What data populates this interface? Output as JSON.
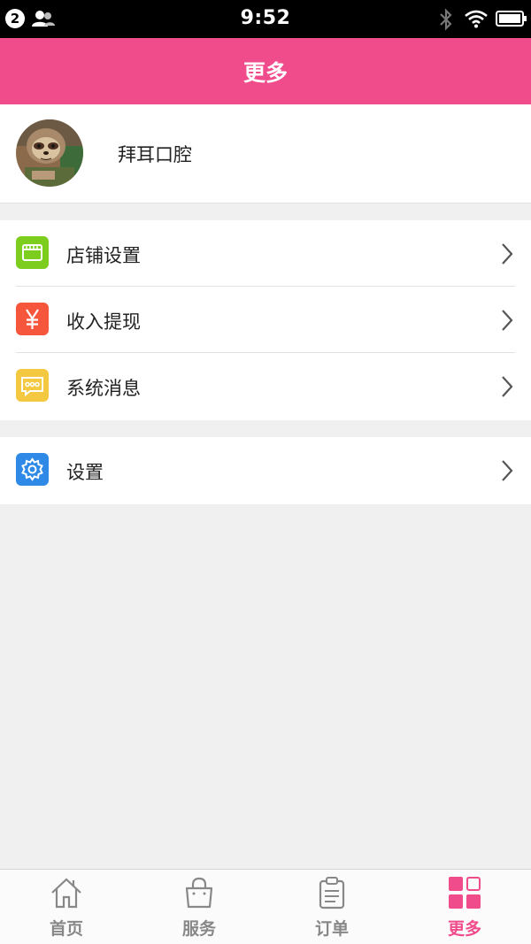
{
  "status_bar": {
    "notification_count": "2",
    "time": "9:52",
    "icons": [
      "user-icon",
      "bluetooth-icon",
      "wifi-icon",
      "battery-icon"
    ]
  },
  "header": {
    "title": "更多"
  },
  "profile": {
    "name": "拜耳口腔",
    "avatar_icon": "avatar-sloth-image"
  },
  "menu_groups": [
    {
      "items": [
        {
          "label": "店铺设置",
          "icon": "store-icon",
          "icon_color": "#7ccd1e"
        },
        {
          "label": "收入提现",
          "icon": "yuan-icon",
          "icon_color": "#f5563c"
        },
        {
          "label": "系统消息",
          "icon": "message-icon",
          "icon_color": "#f5c842"
        }
      ]
    },
    {
      "items": [
        {
          "label": "设置",
          "icon": "gear-icon",
          "icon_color": "#2e8ae6"
        }
      ]
    }
  ],
  "tabbar": {
    "active_index": 3,
    "items": [
      {
        "label": "首页",
        "icon": "home-icon"
      },
      {
        "label": "服务",
        "icon": "bag-icon"
      },
      {
        "label": "订单",
        "icon": "clipboard-icon"
      },
      {
        "label": "更多",
        "icon": "grid-icon"
      }
    ]
  },
  "colors": {
    "accent": "#f04c8c",
    "background": "#f0f0f0",
    "tab_inactive": "#888888"
  }
}
